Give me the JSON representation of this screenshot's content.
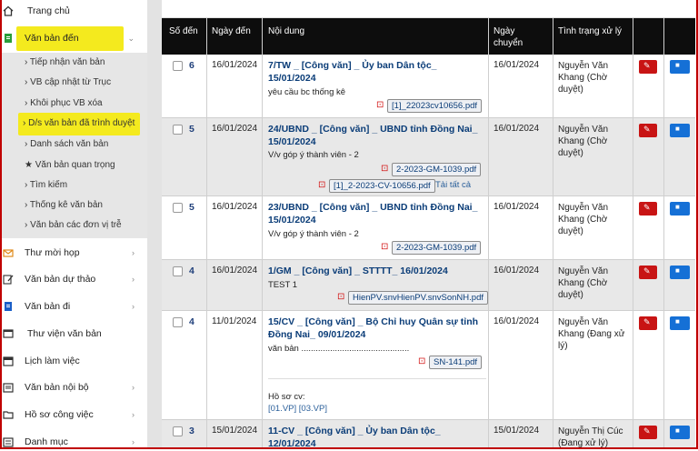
{
  "sidebar": {
    "home": "Trang chủ",
    "incoming": "Văn bản đến",
    "sub": [
      "› Tiếp nhận văn bản",
      "› VB cập nhật từ Trục",
      "› Khôi phục VB xóa",
      "› D/s văn bản đã trình duyệt",
      "› Danh sách văn bản",
      "★ Văn bản quan trọng",
      "› Tìm kiếm",
      "› Thống kê văn bản",
      "› Văn bản các đơn vị trễ"
    ],
    "items": [
      "Thư mời họp",
      "Văn bản dự thảo",
      "Văn bản đi",
      "Thư viện văn bản",
      "Lịch làm việc",
      "Văn bản nội bộ",
      "Hồ sơ công việc",
      "Danh mục"
    ],
    "colors": {
      "highlight": "#f4ea1e",
      "submenu_bg": "#e6e6e6"
    }
  },
  "table": {
    "headers": {
      "number": "Số đến",
      "received_date": "Ngày đến",
      "content": "Nội dung",
      "transfer_date": "Ngày chuyển",
      "status": "Tình trạng xử lý"
    },
    "rows": [
      {
        "number": "6",
        "received_date": "16/01/2024",
        "title": "7/TW _ [Công văn] _ Ủy ban Dân tộc_ 15/01/2024",
        "description": "yêu cầu bc thống kê",
        "files": [
          "[1]_22023cv10656.pdf"
        ],
        "transfer_date": "16/01/2024",
        "status": "Nguyễn Văn Khang (Chờ duyệt)"
      },
      {
        "number": "5",
        "received_date": "16/01/2024",
        "title": "24/UBND _ [Công văn] _ UBND tỉnh Đồng Nai_ 15/01/2024",
        "description": "V/v góp ý thành viên - 2",
        "files": [
          "2-2023-GM-1039.pdf",
          "[1]_2-2023-CV-10656.pdf"
        ],
        "download_all": "Tải tất cả",
        "transfer_date": "16/01/2024",
        "status": "Nguyễn Văn Khang (Chờ duyệt)"
      },
      {
        "number": "5",
        "received_date": "16/01/2024",
        "title": "23/UBND _ [Công văn] _ UBND tỉnh Đồng Nai_ 15/01/2024",
        "description": "V/v góp ý thành viên - 2",
        "files": [
          "2-2023-GM-1039.pdf"
        ],
        "transfer_date": "16/01/2024",
        "status": "Nguyễn Văn Khang (Chờ duyệt)"
      },
      {
        "number": "4",
        "received_date": "16/01/2024",
        "title": "1/GM _ [Công văn] _ STTTT_ 16/01/2024",
        "description": "TEST 1",
        "files": [
          "HienPV.snvHienPV.snvSonNH.pdf"
        ],
        "transfer_date": "16/01/2024",
        "status": "Nguyễn Văn Khang (Chờ duyệt)"
      },
      {
        "number": "4",
        "received_date": "11/01/2024",
        "title": "15/CV _ [Công văn] _ Bộ Chỉ huy Quân sự tỉnh Đồng Nai_ 09/01/2024",
        "description": "văn bản .............................................",
        "files": [
          "SN-141.pdf"
        ],
        "case_label": "Hồ sơ cv:",
        "case_links": "[01.VP] [03.VP]",
        "transfer_date": "16/01/2024",
        "status": "Nguyễn Văn Khang (Đang xử lý)"
      },
      {
        "number": "3",
        "received_date": "15/01/2024",
        "title": "11-CV _ [Công văn] _ Ủy ban Dân tộc_ 12/01/2024",
        "description": "",
        "files": [],
        "transfer_date": "15/01/2024",
        "status": "Nguyễn Thị Cúc (Đang xử lý)"
      }
    ]
  },
  "colors": {
    "header_bg": "#0d0d0d",
    "title": "#0b3d78",
    "edit_btn": "#c81414",
    "print_btn": "#1570d6"
  }
}
